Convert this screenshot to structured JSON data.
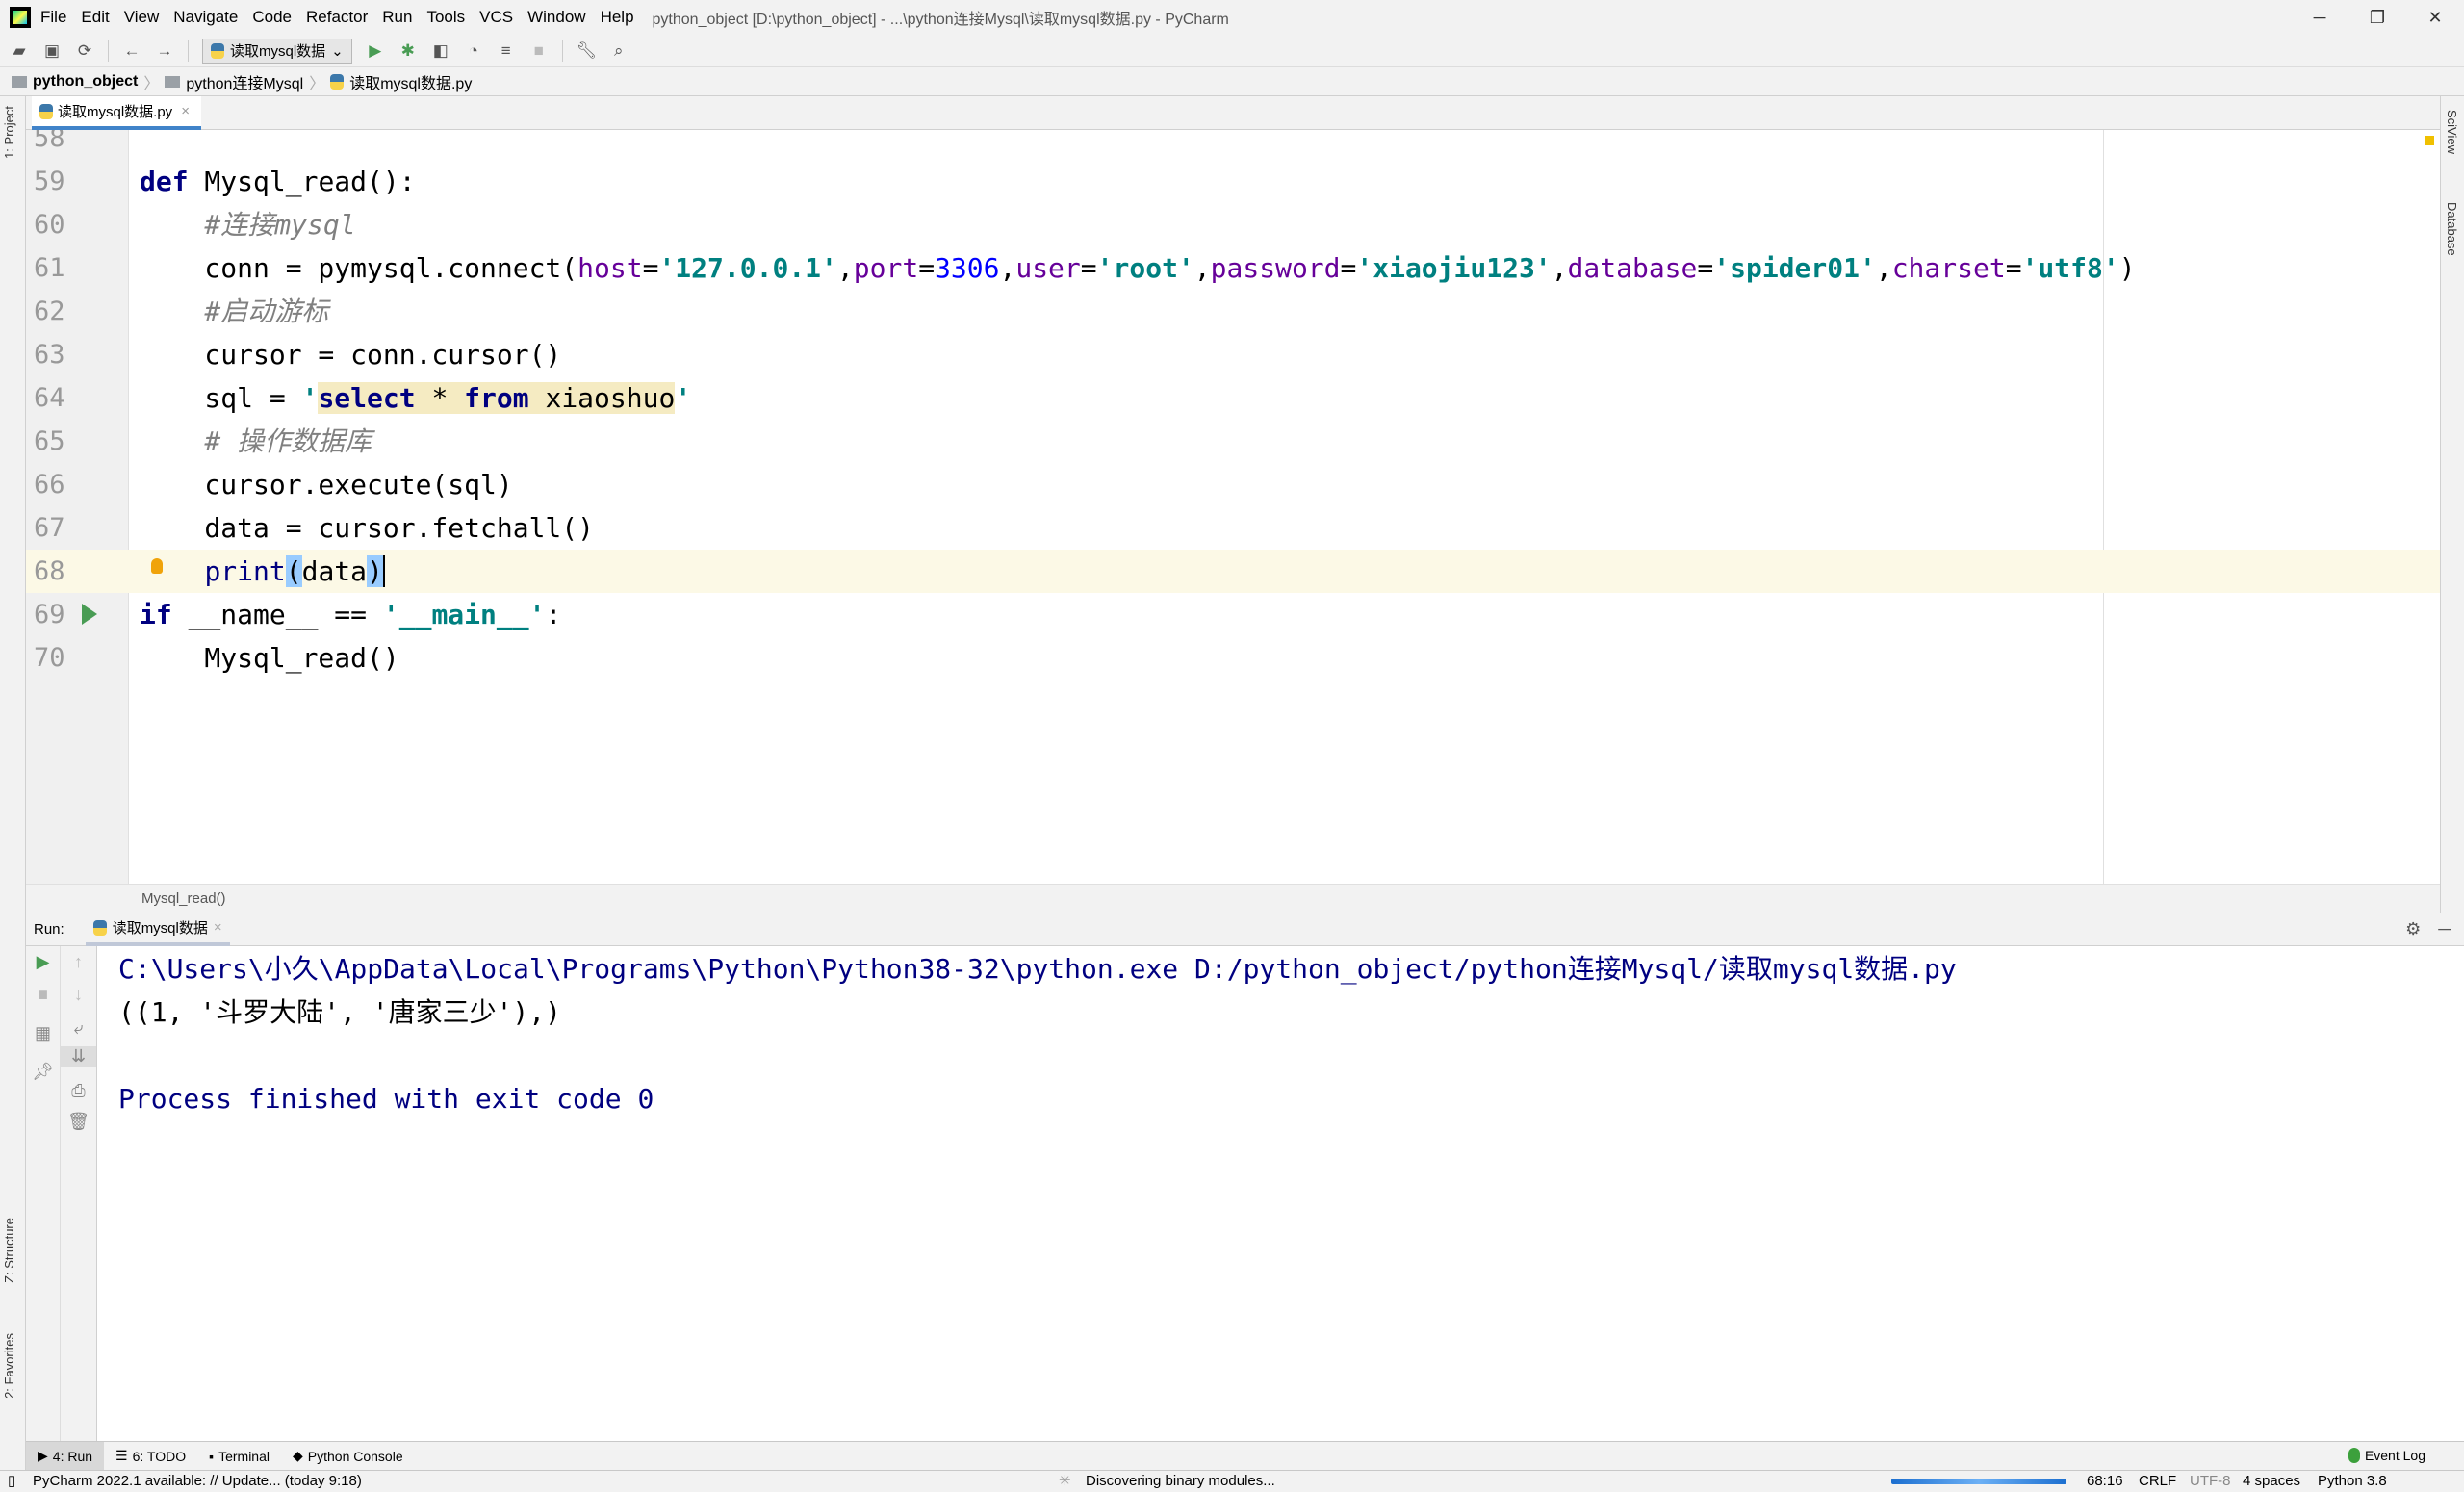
{
  "menubar": {
    "items": [
      "File",
      "Edit",
      "View",
      "Navigate",
      "Code",
      "Refactor",
      "Run",
      "Tools",
      "VCS",
      "Window",
      "Help"
    ],
    "title": "python_object [D:\\python_object] - ...\\python连接Mysql\\读取mysql数据.py - PyCharm"
  },
  "toolbar": {
    "run_config": "读取mysql数据"
  },
  "navbar": {
    "crumbs": [
      "python_object",
      "python连接Mysql",
      "读取mysql数据.py"
    ]
  },
  "left_strip": {
    "project": "1: Project",
    "structure": "Z: Structure",
    "favorites": "2: Favorites"
  },
  "right_strip": {
    "sciview": "SciView",
    "database": "Database"
  },
  "editor": {
    "tab": "读取mysql数据.py",
    "lines": [
      {
        "n": "58",
        "tokens": []
      },
      {
        "n": "59",
        "tokens": [
          [
            "def",
            "kw"
          ],
          [
            " Mysql_read():",
            ""
          ]
        ]
      },
      {
        "n": "60",
        "tokens": [
          [
            "    #连接mysql",
            "cmt"
          ]
        ]
      },
      {
        "n": "61",
        "tokens": [
          [
            "    conn = pymysql.connect(",
            ""
          ],
          [
            "host",
            "par"
          ],
          [
            "=",
            ""
          ],
          [
            "'127.0.0.1'",
            "str"
          ],
          [
            ",",
            ""
          ],
          [
            "port",
            "par"
          ],
          [
            "=",
            ""
          ],
          [
            "3306",
            "num"
          ],
          [
            ",",
            ""
          ],
          [
            "user",
            "par"
          ],
          [
            "=",
            ""
          ],
          [
            "'root'",
            "str"
          ],
          [
            ",",
            ""
          ],
          [
            "password",
            "par"
          ],
          [
            "=",
            ""
          ],
          [
            "'xiaojiu123'",
            "str"
          ],
          [
            ",",
            ""
          ],
          [
            "database",
            "par"
          ],
          [
            "=",
            ""
          ],
          [
            "'spider01'",
            "str"
          ],
          [
            ",",
            ""
          ],
          [
            "charset",
            "par"
          ],
          [
            "=",
            ""
          ],
          [
            "'utf8'",
            "str"
          ],
          [
            ")",
            ""
          ]
        ]
      },
      {
        "n": "62",
        "tokens": [
          [
            "    #启动游标",
            "cmt"
          ]
        ]
      },
      {
        "n": "63",
        "tokens": [
          [
            "    cursor = conn.cursor()",
            ""
          ]
        ]
      },
      {
        "n": "64",
        "tokens": [
          [
            "    sql = ",
            ""
          ],
          [
            "'",
            "str"
          ],
          [
            "select",
            "sqlkw"
          ],
          [
            " * ",
            "sqlid"
          ],
          [
            "from",
            "sqlkw"
          ],
          [
            " xiaoshuo",
            "sqlid"
          ],
          [
            "'",
            "str"
          ]
        ]
      },
      {
        "n": "65",
        "tokens": [
          [
            "    # 操作数据库",
            "cmt"
          ]
        ]
      },
      {
        "n": "66",
        "tokens": [
          [
            "    cursor.execute(sql)",
            ""
          ]
        ]
      },
      {
        "n": "67",
        "tokens": [
          [
            "    data = cursor.fetchall()",
            ""
          ]
        ]
      },
      {
        "n": "68",
        "tokens": [
          [
            "    ",
            ""
          ],
          [
            "print",
            "kw-print"
          ],
          [
            "(",
            "brace"
          ],
          [
            "data",
            ""
          ],
          [
            ")",
            "brace caret"
          ]
        ]
      },
      {
        "n": "69",
        "tokens": [
          [
            "if",
            "kw"
          ],
          [
            " __name__ == ",
            ""
          ],
          [
            "'__main__'",
            "str"
          ],
          [
            ":",
            ""
          ]
        ]
      },
      {
        "n": "70",
        "tokens": [
          [
            "    Mysql_read()",
            ""
          ]
        ]
      }
    ],
    "current_line": "68",
    "breadcrumb": "Mysql_read()"
  },
  "run": {
    "label": "Run:",
    "tab": "读取mysql数据",
    "output": [
      "C:\\Users\\小久\\AppData\\Local\\Programs\\Python\\Python38-32\\python.exe D:/python_object/python连接Mysql/读取mysql数据.py",
      "((1, '斗罗大陆', '唐家三少'),)",
      "",
      "Process finished with exit code 0"
    ]
  },
  "toolwindows": {
    "run": "4: Run",
    "todo": "6: TODO",
    "terminal": "Terminal",
    "console": "Python Console",
    "event_log": "Event Log"
  },
  "status": {
    "update": "PyCharm 2022.1 available: // Update... (today 9:18)",
    "task": "Discovering binary modules...",
    "position": "68:16",
    "line_sep": "CRLF",
    "encoding": "UTF-8",
    "indent": "4 spaces",
    "interpreter": "Python 3.8"
  },
  "colors": {
    "keyword": "#000080",
    "string": "#008080",
    "number": "#0000ff",
    "param": "#660099",
    "comment": "#808080",
    "accent": "#4083c9"
  }
}
